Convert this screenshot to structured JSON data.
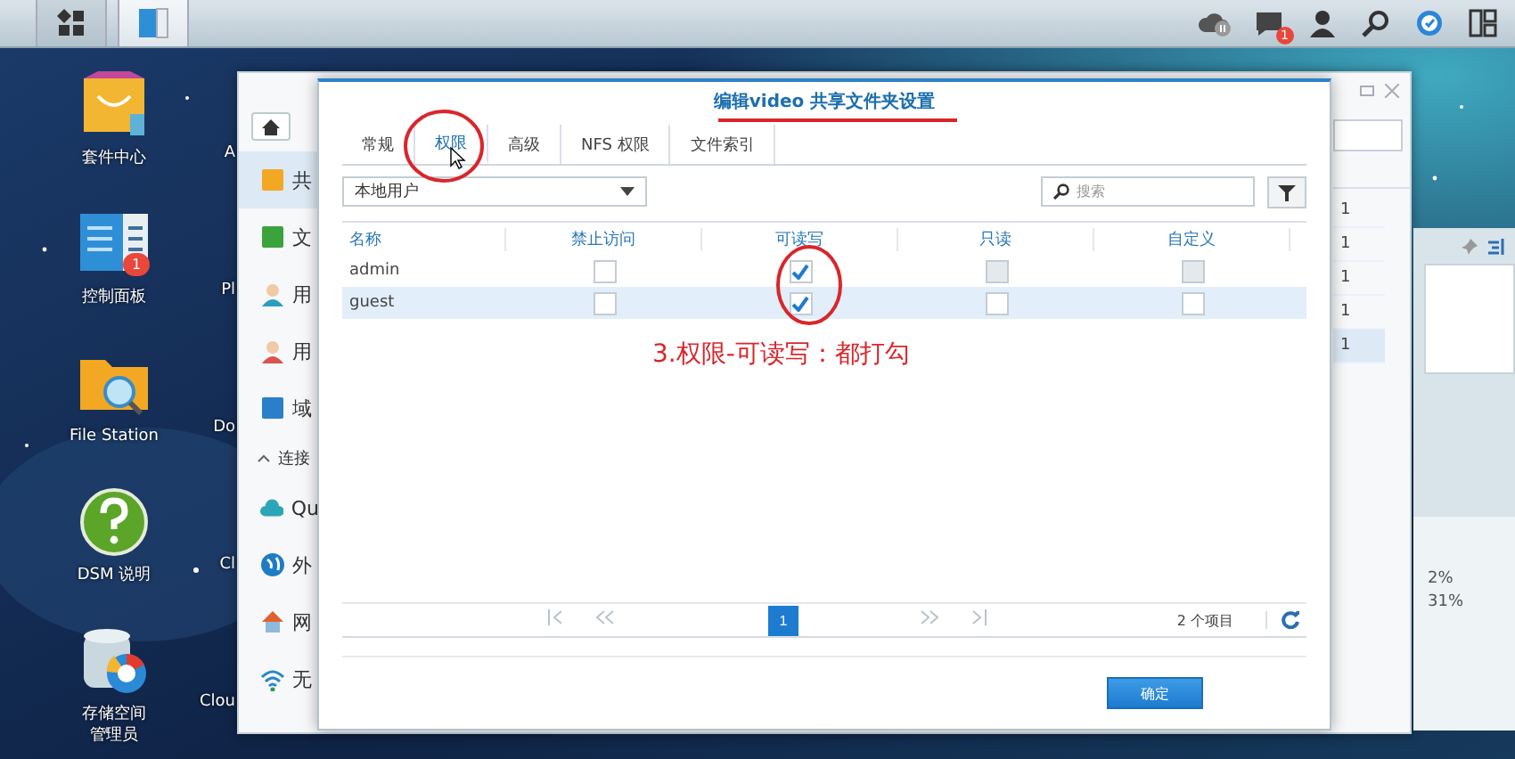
{
  "taskbar": {
    "left_buttons": [
      {
        "kind": "main_menu",
        "selected": false
      },
      {
        "kind": "control_panel",
        "selected": true
      }
    ],
    "right_icons": [
      {
        "kind": "cloud"
      },
      {
        "kind": "chat",
        "badge": "1"
      },
      {
        "kind": "user"
      },
      {
        "kind": "search"
      },
      {
        "kind": "status"
      },
      {
        "kind": "widgets"
      }
    ]
  },
  "desktop_icons": [
    {
      "kind": "package",
      "label": "套件中心"
    },
    {
      "kind": "control_panel",
      "label": "控制面板",
      "badge": "1"
    },
    {
      "kind": "file_station",
      "label": "File Station"
    },
    {
      "kind": "help",
      "label": "DSM 说明"
    },
    {
      "kind": "storage",
      "label": "存储空间管理员"
    }
  ],
  "desktop_icons_partial": [
    "A",
    "Pl",
    "Do",
    "Cl",
    "Clou"
  ],
  "control_panel": {
    "sidebar": [
      {
        "kind": "share",
        "label": "共",
        "selected": true
      },
      {
        "kind": "file_service",
        "label": "文",
        "selected": false
      },
      {
        "kind": "user",
        "label": "用",
        "selected": false
      },
      {
        "kind": "group",
        "label": "用",
        "selected": false
      },
      {
        "kind": "domain",
        "label": "域",
        "selected": false
      },
      {
        "kind": "section",
        "label": "连接",
        "expanded": true
      },
      {
        "kind": "quickconnect",
        "label": "Qu",
        "selected": false
      },
      {
        "kind": "globe",
        "label": "外",
        "selected": false
      },
      {
        "kind": "network",
        "label": "网",
        "selected": false
      },
      {
        "kind": "wifi",
        "label": "无",
        "selected": false
      }
    ],
    "table_rows": [
      {
        "cell": "1",
        "selected": false
      },
      {
        "cell": "1",
        "selected": false
      },
      {
        "cell": "1",
        "selected": false
      },
      {
        "cell": "1",
        "selected": false
      },
      {
        "cell": "1",
        "selected": true
      }
    ]
  },
  "dialog": {
    "title": "编辑video 共享文件夹设置",
    "tabs": [
      {
        "label": "常规",
        "selected": false
      },
      {
        "label": "权限",
        "selected": true
      },
      {
        "label": "高级",
        "selected": false
      },
      {
        "label": "NFS 权限",
        "selected": false
      },
      {
        "label": "文件索引",
        "selected": false
      }
    ],
    "user_filter": {
      "value": "本地用户"
    },
    "search": {
      "placeholder": "搜索"
    },
    "columns": [
      "名称",
      "禁止访问",
      "可读写",
      "只读",
      "自定义"
    ],
    "rows": [
      {
        "name": "admin",
        "selected": false,
        "cells": [
          {
            "checked": false,
            "disabled": false
          },
          {
            "checked": true,
            "disabled": false
          },
          {
            "checked": false,
            "disabled": true
          },
          {
            "checked": false,
            "disabled": true
          }
        ]
      },
      {
        "name": "guest",
        "selected": true,
        "cells": [
          {
            "checked": false,
            "disabled": false
          },
          {
            "checked": true,
            "disabled": false
          },
          {
            "checked": false,
            "disabled": false
          },
          {
            "checked": false,
            "disabled": false
          }
        ]
      }
    ],
    "pager": {
      "pages": [
        {
          "label": "1",
          "selected": true
        }
      ],
      "count": "2 个项目"
    },
    "buttons": [
      {
        "label": "确定",
        "kind": "primary"
      }
    ]
  },
  "annotation": {
    "text": "3.权限-可读写：都打勾"
  },
  "widget": {
    "readings": [
      "2%",
      "31%"
    ]
  }
}
